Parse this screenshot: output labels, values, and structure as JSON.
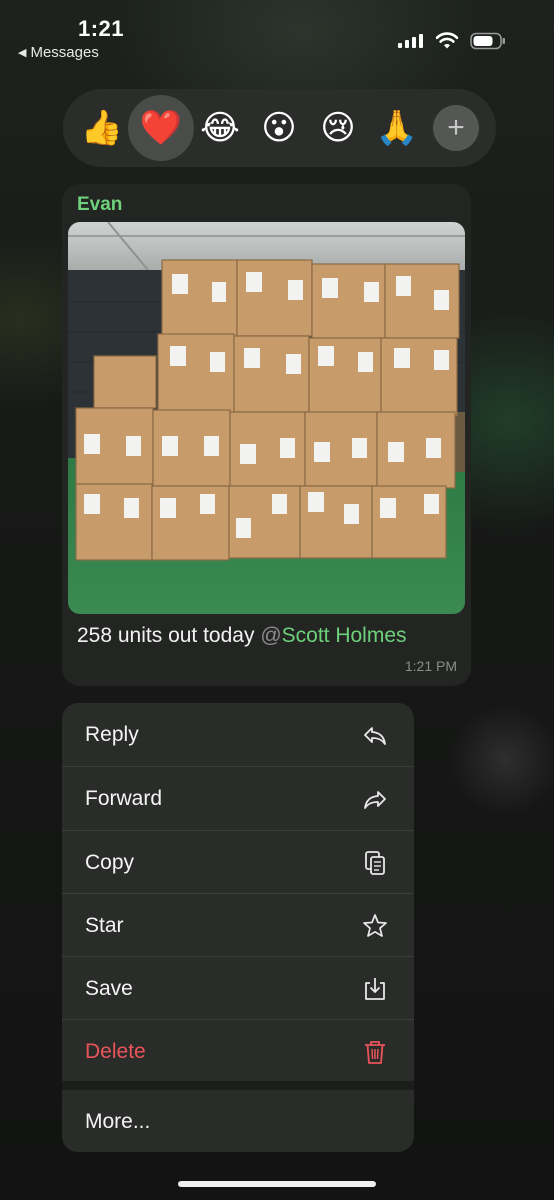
{
  "status_bar": {
    "time": "1:21",
    "back_label": "Messages"
  },
  "reactions": [
    {
      "emoji": "👍",
      "name": "thumbs-up"
    },
    {
      "emoji": "❤️",
      "name": "heart",
      "selected": true
    },
    {
      "emoji": "😂",
      "name": "tears-of-joy"
    },
    {
      "emoji": "😮",
      "name": "surprised"
    },
    {
      "emoji": "😢",
      "name": "crying"
    },
    {
      "emoji": "🙏",
      "name": "pray"
    },
    {
      "emoji": "+",
      "name": "more-reactions"
    }
  ],
  "message": {
    "sender": "Evan",
    "caption_text": "258 units out today ",
    "mention_at": "@",
    "mention_name": "Scott Holmes",
    "time": "1:21 PM",
    "attachment": "photo"
  },
  "menu": {
    "items": [
      {
        "label": "Reply",
        "icon": "reply-icon"
      },
      {
        "label": "Forward",
        "icon": "forward-icon"
      },
      {
        "label": "Copy",
        "icon": "copy-icon"
      },
      {
        "label": "Star",
        "icon": "star-icon"
      },
      {
        "label": "Save",
        "icon": "save-icon"
      },
      {
        "label": "Delete",
        "icon": "trash-icon",
        "danger": true
      },
      {
        "label": "More...",
        "icon": ""
      }
    ]
  },
  "colors": {
    "accent_green": "#6fd07c",
    "danger_red": "#e9545a",
    "menu_bg": "#2a2c2a",
    "bubble_bg": "#232523"
  }
}
